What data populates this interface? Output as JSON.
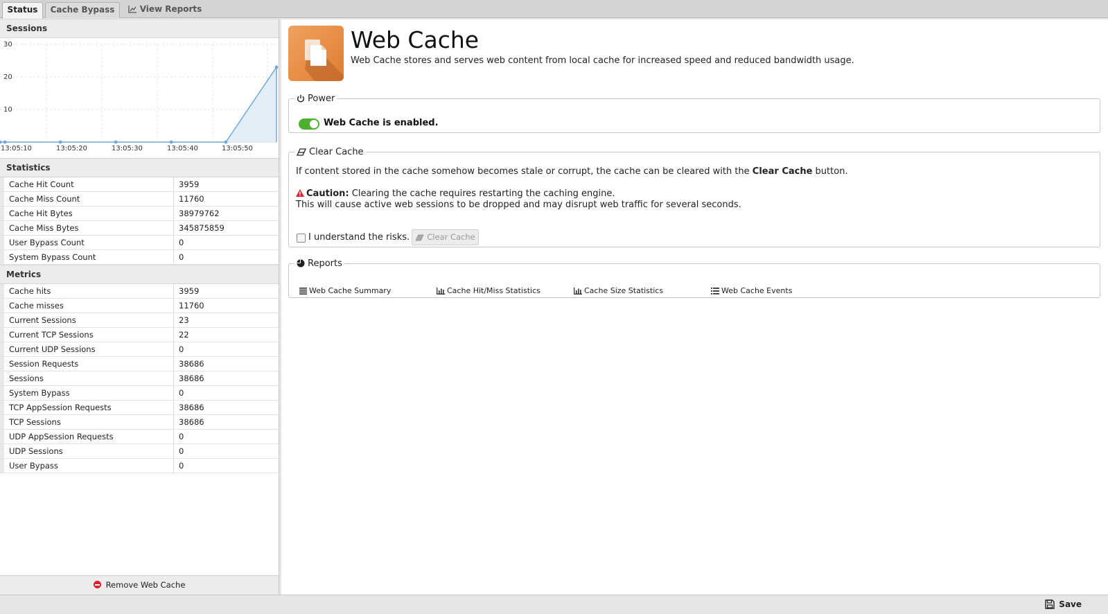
{
  "tabs": [
    {
      "label": "Status",
      "active": true
    },
    {
      "label": "Cache Bypass",
      "active": false
    },
    {
      "label": "View Reports",
      "active": false,
      "icon": "line-chart-icon"
    }
  ],
  "left": {
    "sessions_title": "Sessions",
    "statistics_title": "Statistics",
    "metrics_title": "Metrics",
    "statistics": [
      {
        "label": "Cache Hit Count",
        "value": "3959"
      },
      {
        "label": "Cache Miss Count",
        "value": "11760"
      },
      {
        "label": "Cache Hit Bytes",
        "value": "38979762"
      },
      {
        "label": "Cache Miss Bytes",
        "value": "345875859"
      },
      {
        "label": "User Bypass Count",
        "value": "0"
      },
      {
        "label": "System Bypass Count",
        "value": "0"
      }
    ],
    "metrics": [
      {
        "label": "Cache hits",
        "value": "3959"
      },
      {
        "label": "Cache misses",
        "value": "11760"
      },
      {
        "label": "Current Sessions",
        "value": "23"
      },
      {
        "label": "Current TCP Sessions",
        "value": "22"
      },
      {
        "label": "Current UDP Sessions",
        "value": "0"
      },
      {
        "label": "Session Requests",
        "value": "38686"
      },
      {
        "label": "Sessions",
        "value": "38686"
      },
      {
        "label": "System Bypass",
        "value": "0"
      },
      {
        "label": "TCP AppSession Requests",
        "value": "38686"
      },
      {
        "label": "TCP Sessions",
        "value": "38686"
      },
      {
        "label": "UDP AppSession Requests",
        "value": "0"
      },
      {
        "label": "UDP Sessions",
        "value": "0"
      },
      {
        "label": "User Bypass",
        "value": "0"
      }
    ],
    "remove_label": "Remove Web Cache"
  },
  "chart_data": {
    "type": "area",
    "x": [
      "13:05:05",
      "13:05:10",
      "13:05:20",
      "13:05:30",
      "13:05:40",
      "13:05:50",
      "13:06:00"
    ],
    "x_ticks": [
      "13:05:10",
      "13:05:20",
      "13:05:30",
      "13:05:40",
      "13:05:50"
    ],
    "values": [
      0,
      0,
      0,
      0,
      0,
      0,
      23
    ],
    "y_ticks": [
      10,
      20,
      30
    ],
    "ylim": [
      0,
      30
    ],
    "grid": true,
    "color": "#6fa8dc",
    "fill": "#e4eef9"
  },
  "app": {
    "title": "Web Cache",
    "description": "Web Cache stores and serves web content from local cache for increased speed and reduced bandwidth usage.",
    "accent": "#e8883a"
  },
  "power": {
    "legend": "Power",
    "status_text": "Web Cache is enabled.",
    "enabled": true
  },
  "clear_cache": {
    "legend": "Clear Cache",
    "line1_pre": "If content stored in the cache somehow becomes stale or corrupt, the cache can be cleared with the ",
    "line1_bold": "Clear Cache",
    "line1_post": " button.",
    "caution_label": "Caution:",
    "caution_text": " Clearing the cache requires restarting the caching engine.",
    "line3": "This will cause active web sessions to be dropped and may disrupt web traffic for several seconds.",
    "checkbox_label": "I understand the risks.",
    "button_label": "Clear Cache"
  },
  "reports": {
    "legend": "Reports",
    "links": [
      {
        "label": "Web Cache Summary",
        "icon": "list-icon"
      },
      {
        "label": "Cache Hit/Miss Statistics",
        "icon": "bar-chart-icon"
      },
      {
        "label": "Cache Size Statistics",
        "icon": "bar-chart-icon"
      },
      {
        "label": "Web Cache Events",
        "icon": "list-bullets-icon"
      }
    ]
  },
  "footer": {
    "save_label": "Save"
  }
}
